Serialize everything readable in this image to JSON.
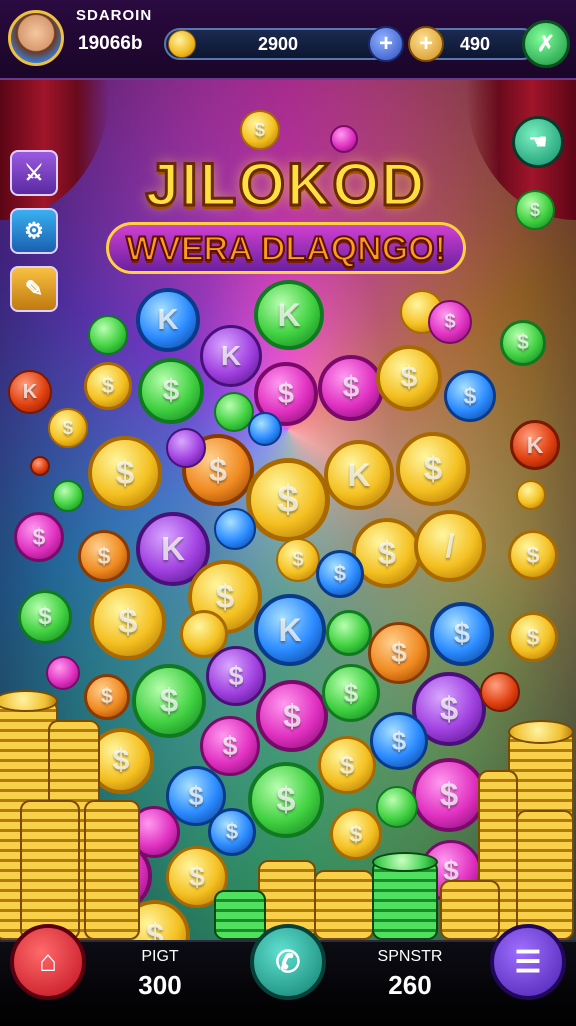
{
  "header": {
    "player_name": "SDAROIN",
    "player_coins": "19066b",
    "balance_value": "2900",
    "gems_value": "490"
  },
  "title": {
    "main": "JILOKOD",
    "sub": "WVERA DLAQNGO!"
  },
  "footer": {
    "left_label": "PIGT",
    "left_value": "300",
    "right_label": "SPNSTR",
    "right_value": "260"
  },
  "icons": {
    "avatar": "avatar",
    "coin": "coin-icon",
    "plus_blue": "plus-icon",
    "plus_gold": "plus-icon",
    "settings": "wrench-icon",
    "side_1": "sword-icon",
    "side_2": "gear-icon",
    "side_3": "pencil-icon",
    "right": "hand-icon",
    "bottom_left": "home-icon",
    "bottom_mid": "phone-icon",
    "bottom_right": "menu-icon"
  },
  "colors": {
    "gold": "#f0c030",
    "pink": "#ff3fc0",
    "green": "#40e050",
    "blue": "#2a8aff",
    "purple": "#a040e0"
  }
}
